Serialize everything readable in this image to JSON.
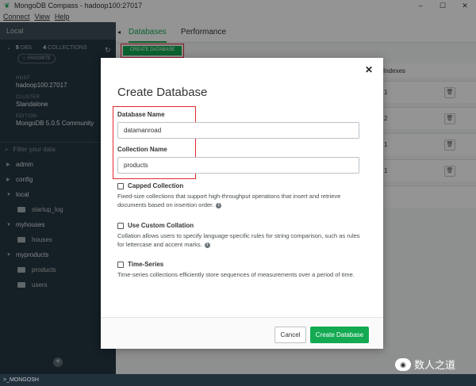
{
  "window": {
    "title": "MongoDB Compass - hadoop100:27017",
    "minimize": "–",
    "maximize": "☐",
    "close": "✕"
  },
  "menu": [
    {
      "label": "Connect"
    },
    {
      "label": "View"
    },
    {
      "label": "Help"
    }
  ],
  "sidebar": {
    "local_label": "Local",
    "dbs_count": "5",
    "dbs_label": "DBS",
    "collections_count": "4",
    "collections_label": "COLLECTIONS",
    "favorite_label": "☆ FAVORITE",
    "host_label": "HOST",
    "host_value": "hadoop100:27017",
    "cluster_label": "CLUSTER",
    "cluster_value": "Standalone",
    "edition_label": "EDITION",
    "edition_value": "MongoDB 5.0.5 Community",
    "filter_placeholder": "Filter your data",
    "databases": [
      {
        "name": "admin",
        "expanded": false,
        "collections": []
      },
      {
        "name": "config",
        "expanded": false,
        "collections": []
      },
      {
        "name": "local",
        "expanded": true,
        "collections": [
          "startup_log"
        ]
      },
      {
        "name": "myhouses",
        "expanded": true,
        "collections": [
          "houses"
        ]
      },
      {
        "name": "myproducts",
        "expanded": true,
        "collections": [
          "products",
          "users"
        ]
      }
    ],
    "add_label": "+"
  },
  "main": {
    "tabs": [
      {
        "label": "Databases",
        "active": true
      },
      {
        "label": "Performance",
        "active": false
      }
    ],
    "create_db_button": "CREATE DATABASE",
    "indexes_header": "Indexes",
    "rows": [
      {
        "indexes": "1"
      },
      {
        "indexes": "2"
      },
      {
        "indexes": "1"
      },
      {
        "indexes": "1"
      }
    ]
  },
  "modal": {
    "title": "Create Database",
    "close_icon": "✕",
    "db_name_label": "Database Name",
    "db_name_value": "datamanroad",
    "collection_name_label": "Collection Name",
    "collection_name_value": "products",
    "options": [
      {
        "label": "Capped Collection",
        "description": "Fixed-size collections that support high-throughput operations that insert and retrieve documents based on insertion order.",
        "info": true
      },
      {
        "label": "Use Custom Collation",
        "description": "Collation allows users to specify language-specific rules for string comparison, such as rules for lettercase and accent marks.",
        "info": true
      },
      {
        "label": "Time-Series",
        "description": "Time-series collections efficiently store sequences of measurements over a period of time.",
        "info": false
      }
    ],
    "cancel_button": "Cancel",
    "create_button": "Create Database"
  },
  "bottom": {
    "mongosh_label": ">_MONGOSH"
  },
  "watermark": {
    "text": "数人之道"
  },
  "colors": {
    "accent": "#13aa52",
    "highlight": "#e0282f",
    "sidebar_bg": "#243642"
  }
}
